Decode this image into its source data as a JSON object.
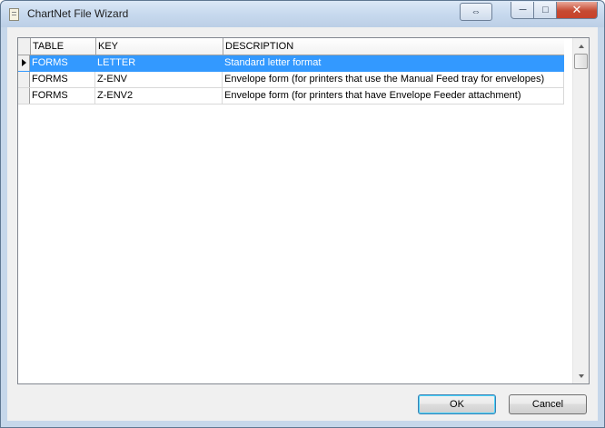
{
  "window": {
    "title": "ChartNet File Wizard",
    "controls": {
      "resize_glyph": "⇔",
      "minimize_glyph": "─",
      "maximize_glyph": "□",
      "close_glyph": "✕"
    }
  },
  "grid": {
    "columns": [
      "TABLE",
      "KEY",
      "DESCRIPTION"
    ],
    "rows": [
      {
        "table": "FORMS",
        "key": "LETTER",
        "description": "Standard letter format",
        "selected": true
      },
      {
        "table": "FORMS",
        "key": "Z-ENV",
        "description": "Envelope form (for printers that use the Manual Feed tray for envelopes)",
        "selected": false
      },
      {
        "table": "FORMS",
        "key": "Z-ENV2",
        "description": "Envelope form (for printers that have Envelope Feeder attachment)",
        "selected": false
      }
    ]
  },
  "buttons": {
    "ok": "OK",
    "cancel": "Cancel"
  },
  "colors": {
    "selection": "#3399ff",
    "titlebar": "#c7d9ee",
    "close_button": "#c8422a"
  }
}
